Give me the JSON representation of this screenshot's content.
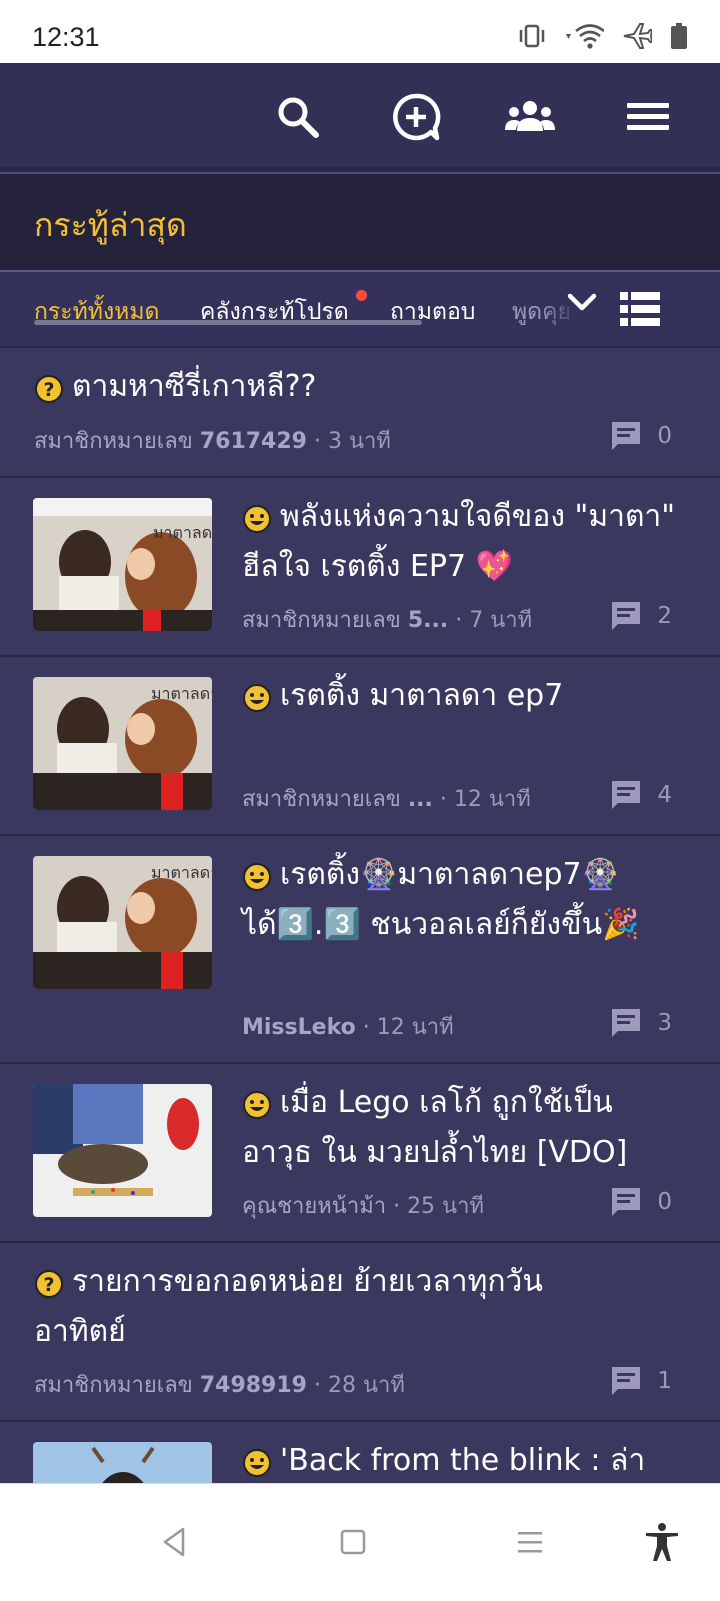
{
  "status_bar": {
    "time": "12:31",
    "icons": [
      "vibrate-icon",
      "wifi-icon",
      "airplane-mode-icon",
      "battery-icon"
    ]
  },
  "app_bar": {
    "icons": [
      "search-icon",
      "new-topic-icon",
      "community-icon",
      "menu-icon"
    ],
    "accent_color": "#f2c133"
  },
  "section": {
    "title": "กระทู้ล่าสุด"
  },
  "tabs": [
    {
      "label": "กระทู้ทั้งหมด",
      "active": true
    },
    {
      "label": "คลังกระทู้โปรด",
      "active": false,
      "notification": true
    },
    {
      "label": "ถามตอบ",
      "active": false
    },
    {
      "label": "พูดคุย",
      "active": false
    }
  ],
  "topics": [
    {
      "type": "question",
      "title": "ตามหาซีรี่เกาหลี??",
      "author_prefix": "สมาชิกหมายเลข",
      "author_id": "7617429",
      "separator": "·",
      "time": "3 นาที",
      "comments": "0",
      "has_thumbnail": false
    },
    {
      "type": "chat",
      "title": "พลังแห่งความใจดีของ \"มาตา\" ฮีลใจ เรตติ้ง EP7 💖",
      "author_prefix": "สมาชิกหมายเลข",
      "author_id": "5...",
      "separator": "·",
      "time": "7 นาที",
      "comments": "2",
      "has_thumbnail": true
    },
    {
      "type": "chat",
      "title": "เรตติ้ง มาตาลดา ep7",
      "author_prefix": "สมาชิกหมายเลข",
      "author_id": "...",
      "separator": "·",
      "time": "12 นาที",
      "comments": "4",
      "has_thumbnail": true
    },
    {
      "type": "chat",
      "title": "เรตติ้ง🎡มาตาลดาep7🎡ได้3️⃣.3️⃣ ชนวอลเลย์ก็ยังขึ้น🎉",
      "author_prefix": "",
      "author_id": "MissLeko",
      "separator": "·",
      "time": "12 นาที",
      "comments": "3",
      "has_thumbnail": true
    },
    {
      "type": "chat",
      "title": "เมื่อ Lego เลโก้ ถูกใช้เป็นอาวุธ ใน มวยปล้ำไทย [VDO]",
      "author_prefix": "",
      "author_id": "คุณชายหน้าม้า",
      "separator": "·",
      "time": "25 นาที",
      "comments": "0",
      "has_thumbnail": true
    },
    {
      "type": "question",
      "title": "รายการขอกอดหน่อย ย้ายเวลาทุกวันอาทิตย์",
      "author_prefix": "สมาชิกหมายเลข",
      "author_id": "7498919",
      "separator": "·",
      "time": "28 นาที",
      "comments": "1",
      "has_thumbnail": false
    },
    {
      "type": "chat",
      "title": "'Back from the blink : ล่า",
      "has_thumbnail": true
    }
  ],
  "nav_bar": {
    "icons": [
      "back-icon",
      "home-icon",
      "recents-icon",
      "accessibility-icon"
    ]
  }
}
